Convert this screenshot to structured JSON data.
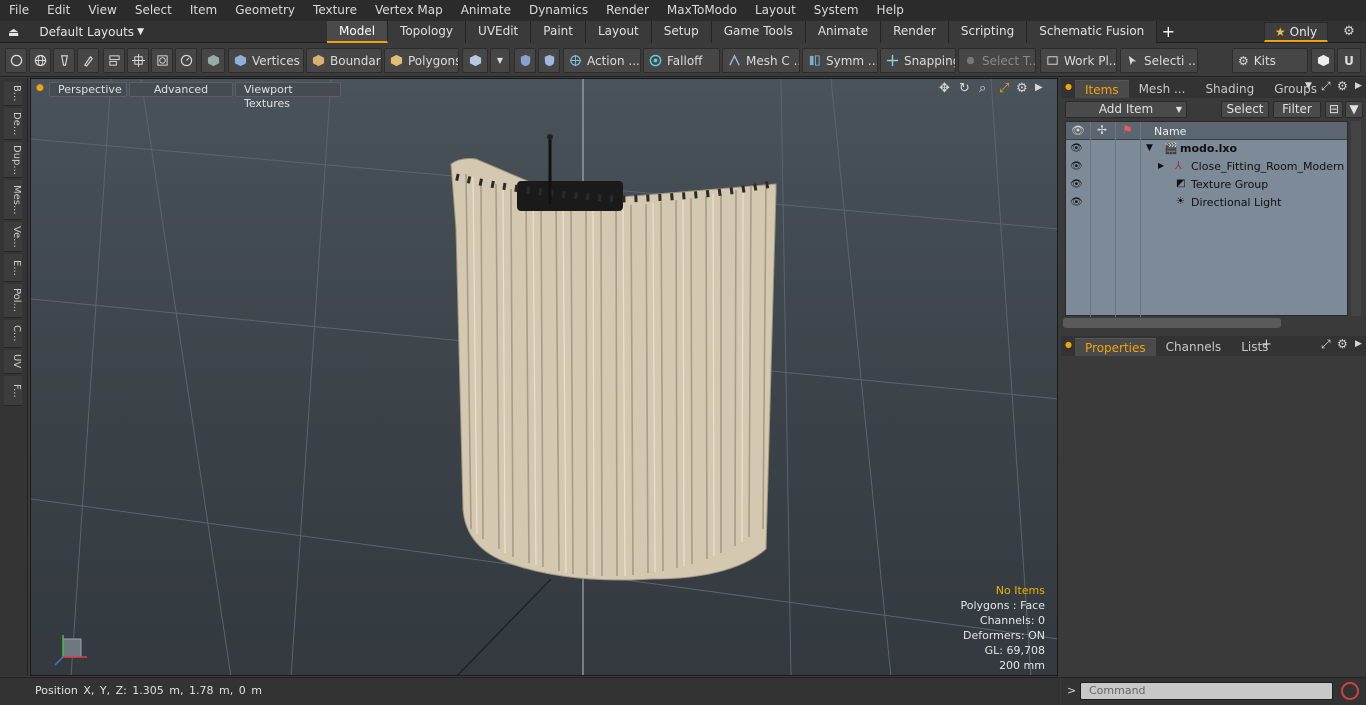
{
  "menu": [
    "File",
    "Edit",
    "View",
    "Select",
    "Item",
    "Geometry",
    "Texture",
    "Vertex Map",
    "Animate",
    "Dynamics",
    "Render",
    "MaxToModo",
    "Layout",
    "System",
    "Help"
  ],
  "layouts": {
    "label": "Default Layouts"
  },
  "tabs": [
    "Model",
    "Topology",
    "UVEdit",
    "Paint",
    "Layout",
    "Setup",
    "Game Tools",
    "Animate",
    "Render",
    "Scripting",
    "Schematic Fusion"
  ],
  "only_label": "Only",
  "toolbar": {
    "vertices": "Vertices",
    "boundary": "Boundary",
    "polygons": "Polygons",
    "action": "Action ...",
    "falloff": "Falloff",
    "mesh": "Mesh C ...",
    "symm": "Symm ...",
    "snapping": "Snapping",
    "select_t": "Select T...",
    "workpl": "Work Pl...",
    "selecti": "Selecti ...",
    "kits": "Kits"
  },
  "lefttabs": [
    "B...",
    "De...",
    "Dup...",
    "Mes...",
    "Ve...",
    "E...",
    "Pol...",
    "C...",
    "UV",
    "F..."
  ],
  "viewport": {
    "perspective": "Perspective",
    "advanced": "Advanced",
    "textures": "Viewport Textures"
  },
  "info": {
    "no_items": "No Items",
    "polygons": "Polygons : Face",
    "channels": "Channels: 0",
    "deformers": "Deformers: ON",
    "gl": "GL: 69,708",
    "scale": "200 mm"
  },
  "status": {
    "position": "Position X, Y, Z:   1.305 m, 1.78 m, 0 m"
  },
  "items_panel": {
    "tabs": [
      "Items",
      "Mesh ...",
      "Shading",
      "Groups"
    ],
    "add_item": "Add Item",
    "select": "Select",
    "filter": "Filter",
    "name_col": "Name",
    "rows": [
      {
        "label": "modo.lxo"
      },
      {
        "label": "Close_Fitting_Room_Modern"
      },
      {
        "label": "Texture Group"
      },
      {
        "label": "Directional Light"
      }
    ]
  },
  "props_panel": {
    "tabs": [
      "Properties",
      "Channels",
      "Lists"
    ]
  },
  "command": {
    "placeholder": "Command"
  },
  "colors": {
    "accent": "#f0a30a",
    "viewport_top": "#4a525a",
    "curtain": "#d6cab3"
  }
}
